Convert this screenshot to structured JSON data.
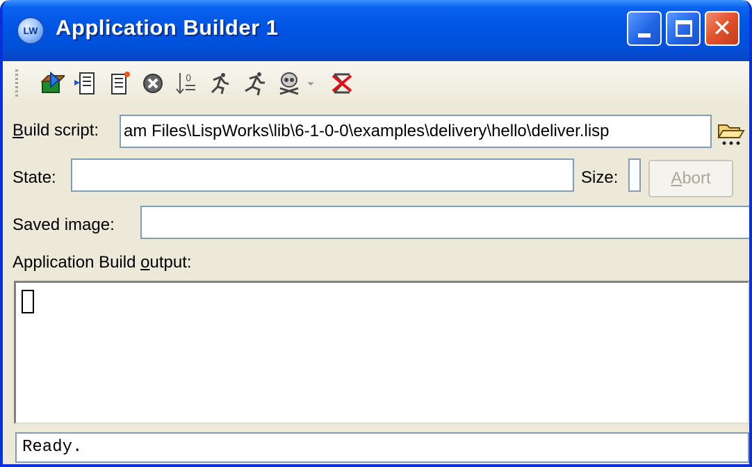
{
  "window": {
    "title": "Application Builder 1",
    "icon_text": "LW"
  },
  "toolbar": {
    "buttons": [
      {
        "icon": "build-icon"
      },
      {
        "icon": "edit-script-icon"
      },
      {
        "icon": "new-script-icon"
      },
      {
        "icon": "stop-icon"
      },
      {
        "icon": "sort-icon"
      },
      {
        "icon": "run-icon"
      },
      {
        "icon": "run-alt-icon"
      },
      {
        "icon": "skull-icon"
      },
      {
        "icon": "dropdown-arrow-icon"
      },
      {
        "icon": "clear-icon"
      }
    ]
  },
  "build_script": {
    "label_underlined": "B",
    "label_rest": "uild script:",
    "value": "am Files\\LispWorks\\lib\\6-1-0-0\\examples\\delivery\\hello\\deliver.lisp"
  },
  "state": {
    "label": "State:",
    "value": ""
  },
  "size": {
    "label": "Size:",
    "value": ""
  },
  "abort": {
    "label_underlined": "A",
    "label_rest": "bort"
  },
  "saved_image": {
    "label": "Saved image:",
    "value": ""
  },
  "output": {
    "label_pre": "Application Build ",
    "label_underlined": "o",
    "label_rest": "utput:"
  },
  "status": {
    "text": "Ready."
  },
  "colors": {
    "titlebar": "#0054e3",
    "close_button": "#e0502a",
    "window_bg": "#ece9d8",
    "field_border": "#7f9db9"
  }
}
